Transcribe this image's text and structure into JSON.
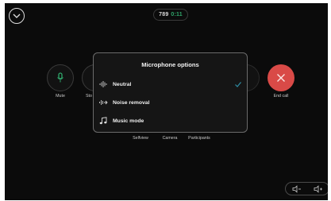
{
  "header": {
    "timer_primary": "789",
    "timer_secondary": "0:11"
  },
  "controls": {
    "mute_label": "Mute",
    "stop_label": "Sto",
    "selfview_label": "Selfview",
    "camera_label": "Camera",
    "participants_label": "Participants",
    "share_label": "e",
    "end_call_label": "End call"
  },
  "dialog": {
    "title": "Microphone options",
    "options": [
      {
        "label": "Neutral",
        "icon": "waveform-icon",
        "selected": true
      },
      {
        "label": "Noise removal",
        "icon": "noise-removal-icon",
        "selected": false
      },
      {
        "label": "Music mode",
        "icon": "music-note-icon",
        "selected": false
      }
    ]
  },
  "colors": {
    "background": "#0b0b0b",
    "accent_green": "#2fa56a",
    "end_call_red": "#d94a47",
    "check_teal": "#2f8fa6"
  }
}
